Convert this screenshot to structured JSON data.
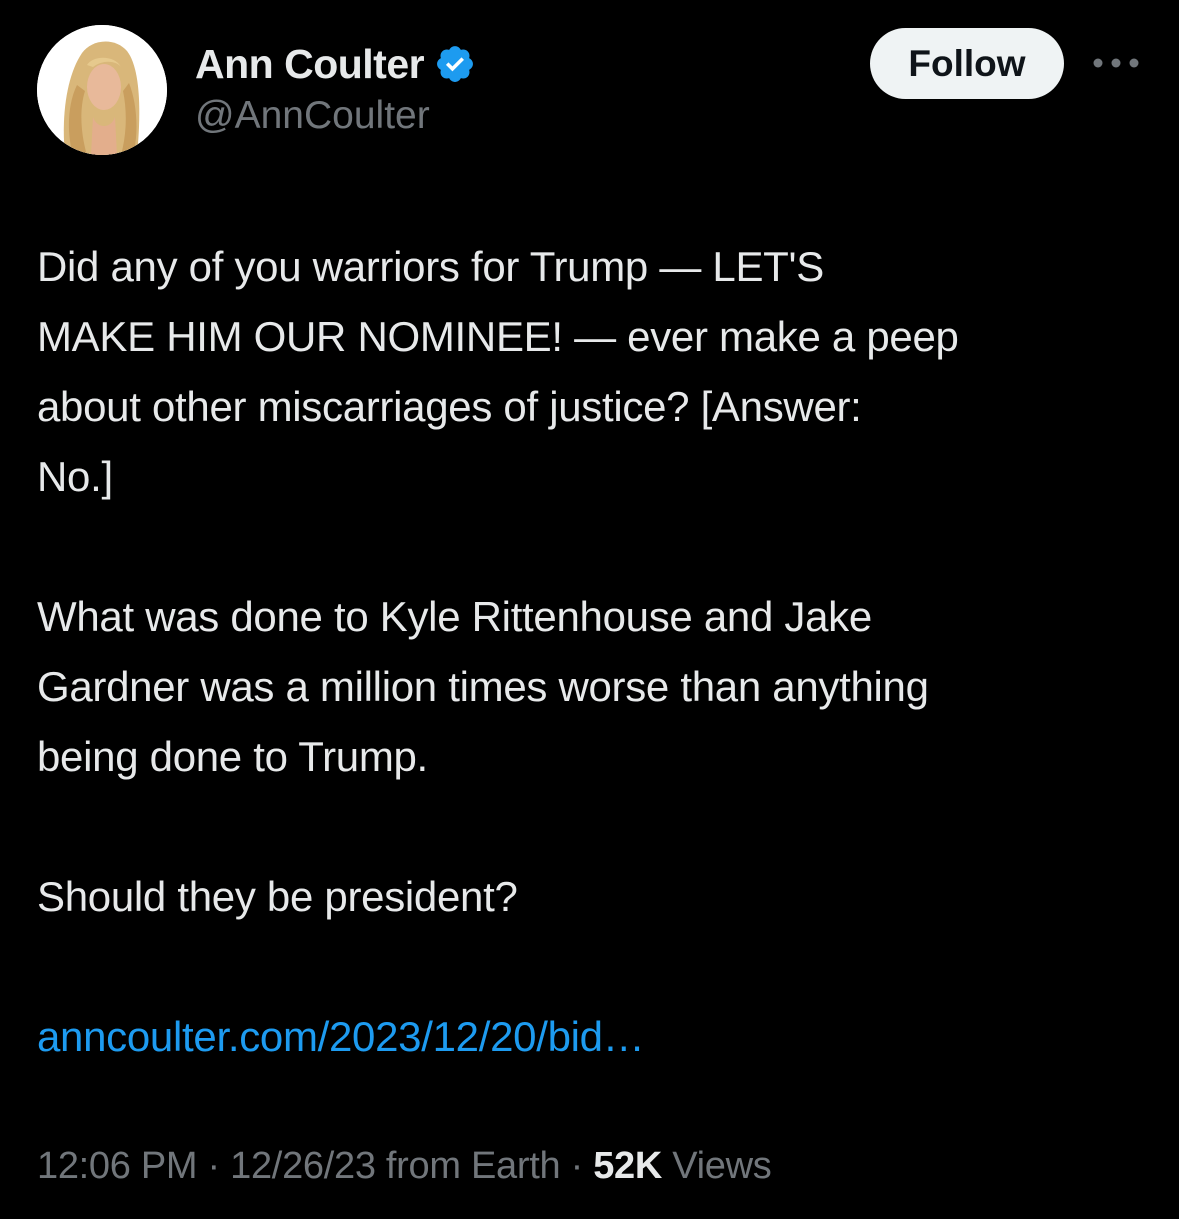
{
  "author": {
    "display_name": "Ann Coulter",
    "handle": "@AnnCoulter",
    "verified_icon": "verified-badge-icon",
    "verified_color": "#1d9bf0"
  },
  "actions": {
    "follow_label": "Follow",
    "more_icon": "more-dots-icon"
  },
  "tweet": {
    "lines_p1": [
      "Did any of you warriors for Trump — LET'S",
      "MAKE HIM OUR NOMINEE! — ever make a peep",
      "about other miscarriages of justice?  [Answer:",
      "No.]"
    ],
    "lines_p2": [
      "What was done to Kyle Rittenhouse and Jake",
      "Gardner was a million times worse than anything",
      "being done to Trump."
    ],
    "line_p3": "Should they be president?",
    "link_text": "anncoulter.com/2023/12/20/bid…"
  },
  "meta": {
    "time": "12:06 PM",
    "separator": " · ",
    "date": "12/26/23",
    "source": " from Earth",
    "views_count": "52K",
    "views_label": " Views"
  },
  "colors": {
    "background": "#000000",
    "text": "#e7e9ea",
    "secondary": "#71767b",
    "link": "#1d9bf0",
    "follow_bg": "#eff3f4"
  }
}
